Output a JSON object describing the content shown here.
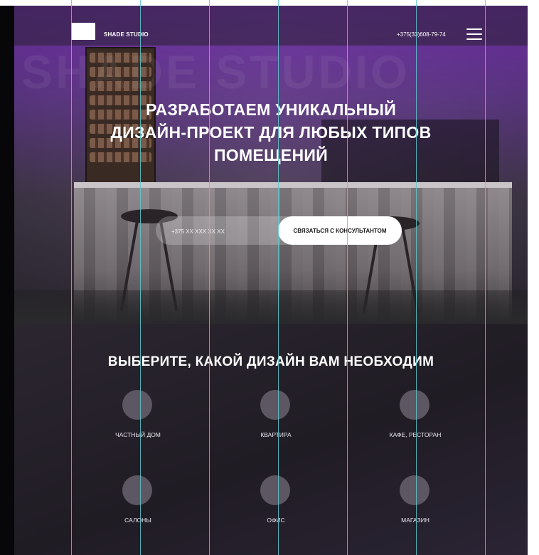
{
  "header": {
    "brand": "SHADE STUDIO",
    "phone": "+375(33)608-79-74",
    "menu_icon": "hamburger-menu-icon"
  },
  "hero": {
    "watermark": "SHADE STUDIO",
    "title_lines": [
      "Разработаем уникальный",
      "дизайн-проект для любых типов",
      "помещений"
    ],
    "phone_placeholder": "+375 XX XXX XX XX",
    "cta_label": "Связаться с консультантом"
  },
  "design_section": {
    "title": "Выберите, какой дизайн вам необходим",
    "items": [
      {
        "label": "Частный дом"
      },
      {
        "label": "Квартира"
      },
      {
        "label": "Кафе, ресторан"
      },
      {
        "label": "Салоны"
      },
      {
        "label": "Офис"
      },
      {
        "label": "Магазин"
      }
    ]
  },
  "colors": {
    "accent_purple": "#7a2ec0",
    "background_dark": "#201c22",
    "guide_lines": "#5fc8cc",
    "button_bg": "#ffffff"
  }
}
